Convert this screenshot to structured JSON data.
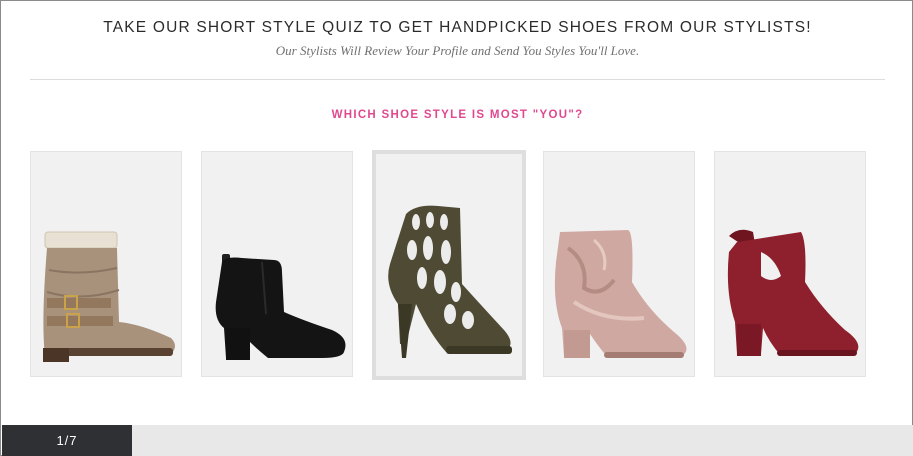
{
  "header": {
    "title": "TAKE OUR SHORT STYLE QUIZ TO GET HANDPICKED SHOES FROM OUR STYLISTS!",
    "subtitle": "Our Stylists Will Review Your Profile and Send You Styles You'll Love."
  },
  "quiz": {
    "question": "WHICH SHOE STYLE IS MOST \"YOU\"?",
    "options": [
      {
        "name": "slouchy-buckle-boot",
        "color": "#a8927c"
      },
      {
        "name": "black-suede-chelsea-bootie",
        "color": "#141414"
      },
      {
        "name": "olive-cutout-heel",
        "color": "#4f4a34"
      },
      {
        "name": "blush-velvet-bootie",
        "color": "#cfa9a1"
      },
      {
        "name": "burgundy-tie-bootie",
        "color": "#8e1f2c"
      }
    ],
    "selected_index": 2
  },
  "progress": {
    "label": "1/7",
    "fraction": 0.1428
  },
  "colors": {
    "accent_pink": "#e0488f",
    "progress_dark": "#2e3033",
    "progress_track": "#e8e8e8"
  }
}
